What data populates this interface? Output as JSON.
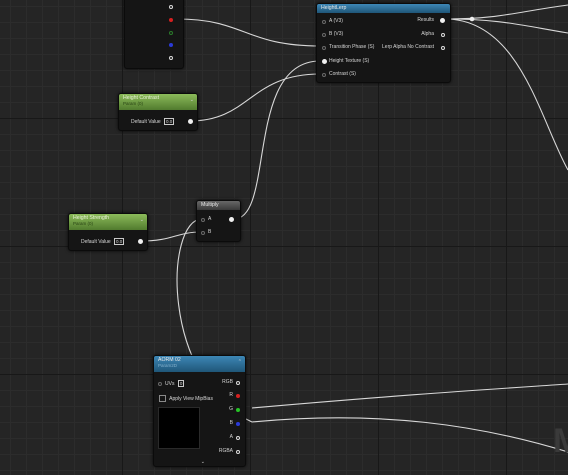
{
  "nodes": {
    "top_partial": {},
    "height_lerp": {
      "title": "HeightLerp",
      "inputs": [
        "A (V3)",
        "B (V3)",
        "Transition Phase (S)",
        "Height Texture (S)",
        "Contrast (S)"
      ],
      "outputs": [
        "Results",
        "Alpha",
        "Lerp Alpha No Contrast"
      ]
    },
    "height_contrast": {
      "title": "Height Contrast",
      "subtitle": "Param (0)",
      "default_label": "Default Value",
      "default_value": "0.0"
    },
    "height_strength": {
      "title": "Height Strength",
      "subtitle": "Param (0)",
      "default_label": "Default Value",
      "default_value": "0.0"
    },
    "multiply": {
      "title": "Multiply",
      "inputs": [
        "A",
        "B"
      ]
    },
    "aorm": {
      "title": "AORM 02",
      "subtitle": "Param2D",
      "uvs_label": "UVs",
      "uvs_value": "0",
      "mip_label": "Apply View MipBias",
      "outputs": [
        "RGB",
        "R",
        "G",
        "B",
        "A",
        "RGBA"
      ]
    }
  },
  "watermark_letter": "M"
}
